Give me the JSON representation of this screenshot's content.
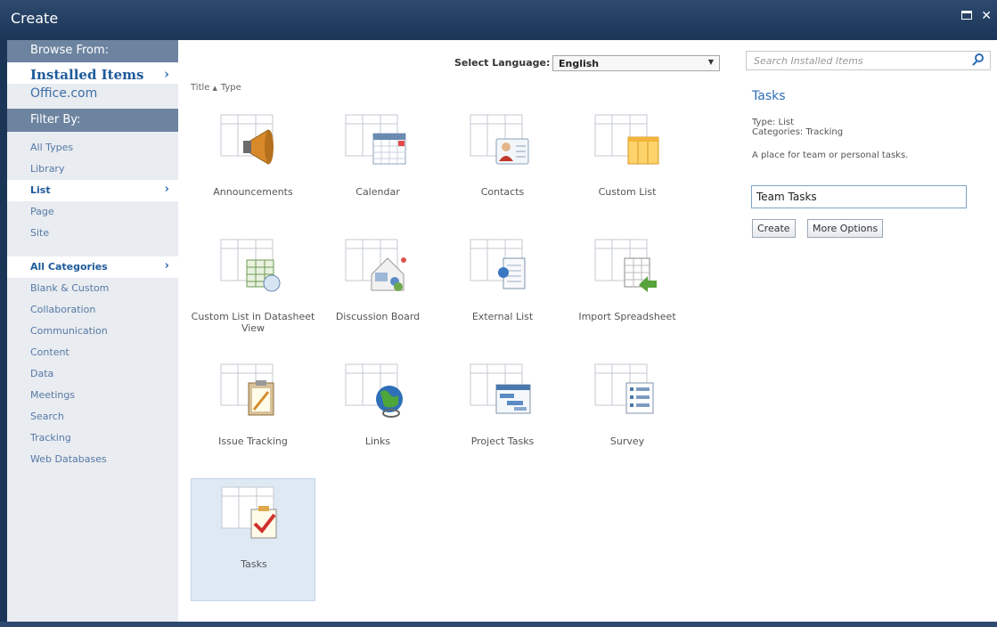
{
  "window": {
    "title": "Create"
  },
  "sidebar": {
    "browse_header": "Browse From:",
    "browse_items": [
      {
        "label": "Installed Items",
        "selected": true
      },
      {
        "label": "Office.com",
        "selected": false
      }
    ],
    "filter_header": "Filter By:",
    "type_filters": [
      {
        "label": "All Types",
        "selected": false
      },
      {
        "label": "Library",
        "selected": false
      },
      {
        "label": "List",
        "selected": true
      },
      {
        "label": "Page",
        "selected": false
      },
      {
        "label": "Site",
        "selected": false
      }
    ],
    "category_filters": [
      {
        "label": "All Categories",
        "selected": true
      },
      {
        "label": "Blank & Custom",
        "selected": false
      },
      {
        "label": "Collaboration",
        "selected": false
      },
      {
        "label": "Communication",
        "selected": false
      },
      {
        "label": "Content",
        "selected": false
      },
      {
        "label": "Data",
        "selected": false
      },
      {
        "label": "Meetings",
        "selected": false
      },
      {
        "label": "Search",
        "selected": false
      },
      {
        "label": "Tracking",
        "selected": false
      },
      {
        "label": "Web Databases",
        "selected": false
      }
    ]
  },
  "main": {
    "language_label": "Select Language:",
    "language_value": "English",
    "sort": {
      "title": "Title",
      "type": "Type"
    },
    "templates": [
      {
        "label": "Announcements",
        "icon": "megaphone"
      },
      {
        "label": "Calendar",
        "icon": "calendar"
      },
      {
        "label": "Contacts",
        "icon": "contact-card"
      },
      {
        "label": "Custom List",
        "icon": "columns"
      },
      {
        "label": "Custom List in Datasheet View",
        "icon": "datasheet"
      },
      {
        "label": "Discussion Board",
        "icon": "discussion"
      },
      {
        "label": "External List",
        "icon": "external"
      },
      {
        "label": "Import Spreadsheet",
        "icon": "import"
      },
      {
        "label": "Issue Tracking",
        "icon": "clipboard-pencil"
      },
      {
        "label": "Links",
        "icon": "globe-link"
      },
      {
        "label": "Project Tasks",
        "icon": "gantt"
      },
      {
        "label": "Survey",
        "icon": "survey"
      },
      {
        "label": "Tasks",
        "icon": "checkmark"
      }
    ],
    "selected_template": "Tasks"
  },
  "details": {
    "search_placeholder": "Search Installed Items",
    "title": "Tasks",
    "type_line": "Type: List",
    "categories_line": "Categories: Tracking",
    "description": "A place for team or personal tasks.",
    "name_value": "Team Tasks",
    "create_label": "Create",
    "more_options_label": "More Options"
  },
  "colors": {
    "titlebar": "#1b3557",
    "sidebar_header": "#6d84a0",
    "sidebar_bg": "#e9ecf0",
    "link": "#2d6db5",
    "selected_tile": "#dfe9f4"
  }
}
